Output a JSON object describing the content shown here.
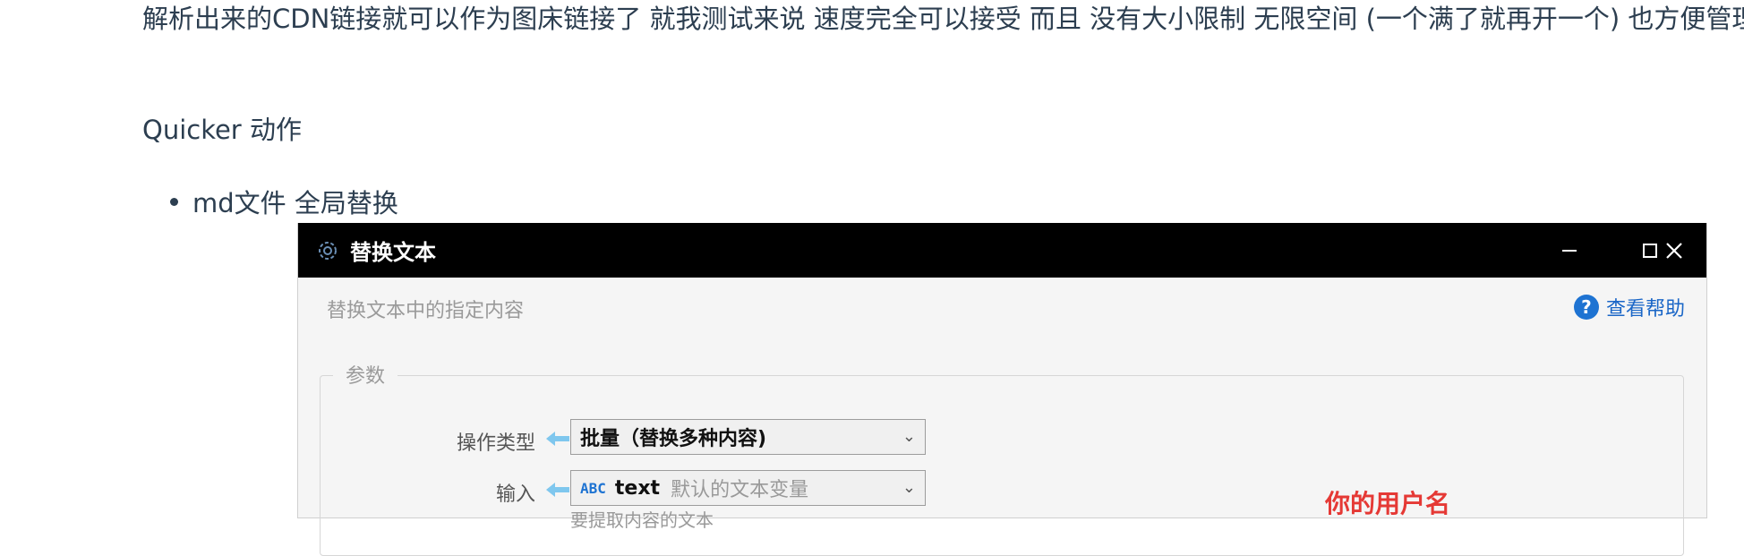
{
  "article": {
    "paragraph": "解析出来的CDN链接就可以作为图床链接了 就我测试来说 速度完全可以接受 而且 没有大小限制 无限空间 (一个满了就再开一个) 也方便管理",
    "heading": "Quicker 动作",
    "bullets": [
      "md文件 全局替换"
    ]
  },
  "window": {
    "title": "替换文本",
    "subtitle": "替换文本中的指定内容",
    "help_label": "查看帮助",
    "group_label": "参数",
    "fields": [
      {
        "label": "操作类型",
        "value": "批量（替换多种内容)"
      },
      {
        "label": "输入",
        "badge": "ABC",
        "value": "text",
        "hint": "默认的文本变量"
      }
    ],
    "input_hint_below": "要提取内容的文本",
    "annotation": "你的用户名"
  },
  "colors": {
    "titlebar": "#000000",
    "accent": "#1e73d2",
    "arrow": "#7fc7ee",
    "annotation": "#e53935"
  }
}
